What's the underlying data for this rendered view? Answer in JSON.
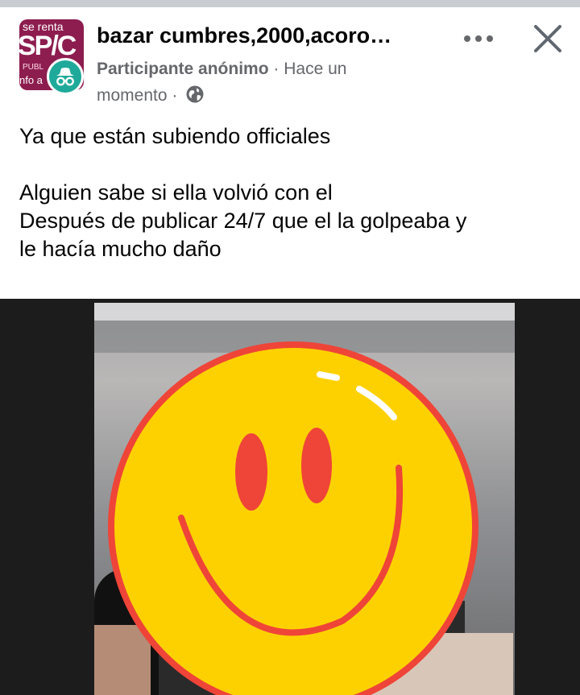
{
  "post": {
    "group_name": "bazar cumbres,2000,acoro…",
    "author": "Participante anónimo",
    "time_prefix": "· Hace un",
    "time_suffix": "momento ·",
    "privacy_icon": "globe-icon",
    "text_line1": "Ya que están subiendo officiales",
    "text_line2": "Alguien sabe si ella volvió con el",
    "text_line3": "Después de publicar 24/7 que el la golpeaba y",
    "text_line4": "le hacía mucho daño"
  },
  "group_avatar": {
    "top_text": "se renta",
    "big_text": "SP/C",
    "mid_text": "PUBL",
    "bottom_text": "nfo a"
  },
  "colors": {
    "accent_avatar": "#8d1d4f",
    "anon_badge": "#1fa99a",
    "smiley_fill": "#fdd100",
    "smiley_stroke": "#ef4438"
  }
}
